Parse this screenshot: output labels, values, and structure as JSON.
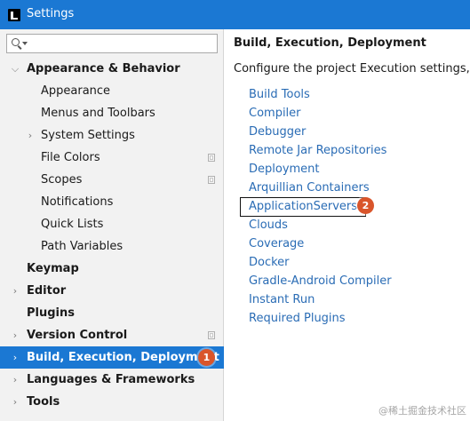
{
  "window": {
    "title": "Settings",
    "icon": "intellij-app-icon"
  },
  "search": {
    "value": "",
    "placeholder": ""
  },
  "sidebar": {
    "items": [
      {
        "label": "Appearance & Behavior",
        "bold": true,
        "chevron": "expanded"
      },
      {
        "label": "Appearance"
      },
      {
        "label": "Menus and Toolbars"
      },
      {
        "label": "System Settings",
        "chevron": "collapsed"
      },
      {
        "label": "File Colors",
        "project_icon": true
      },
      {
        "label": "Scopes",
        "project_icon": true
      },
      {
        "label": "Notifications"
      },
      {
        "label": "Quick Lists"
      },
      {
        "label": "Path Variables"
      },
      {
        "label": "Keymap",
        "bold": true
      },
      {
        "label": "Editor",
        "bold": true,
        "chevron": "collapsed"
      },
      {
        "label": "Plugins",
        "bold": true
      },
      {
        "label": "Version Control",
        "bold": true,
        "chevron": "collapsed",
        "project_icon": true
      },
      {
        "label": "Build, Execution, Deployment",
        "bold": true,
        "chevron": "collapsed",
        "selected": true,
        "step_badge": "1"
      },
      {
        "label": "Languages & Frameworks",
        "bold": true,
        "chevron": "collapsed"
      },
      {
        "label": "Tools",
        "bold": true,
        "chevron": "collapsed"
      }
    ]
  },
  "main": {
    "heading": "Build, Execution, Deployment",
    "description": "Configure the project Execution settings, set u",
    "links": [
      {
        "label": "Build Tools"
      },
      {
        "label": "Compiler"
      },
      {
        "label": "Debugger"
      },
      {
        "label": "Remote Jar Repositories"
      },
      {
        "label": "Deployment"
      },
      {
        "label": "Arquillian Containers"
      },
      {
        "label": "ApplicationServers",
        "highlighted": true,
        "step_badge": "2"
      },
      {
        "label": "Clouds"
      },
      {
        "label": "Coverage"
      },
      {
        "label": "Docker"
      },
      {
        "label": "Gradle-Android Compiler"
      },
      {
        "label": "Instant Run"
      },
      {
        "label": "Required Plugins"
      }
    ]
  },
  "watermark": "@稀土掘金技术社区",
  "colors": {
    "accent": "#1b78d3",
    "link": "#2a6cb5",
    "badge": "#d9552b",
    "sidebar_bg": "#f2f2f2"
  }
}
